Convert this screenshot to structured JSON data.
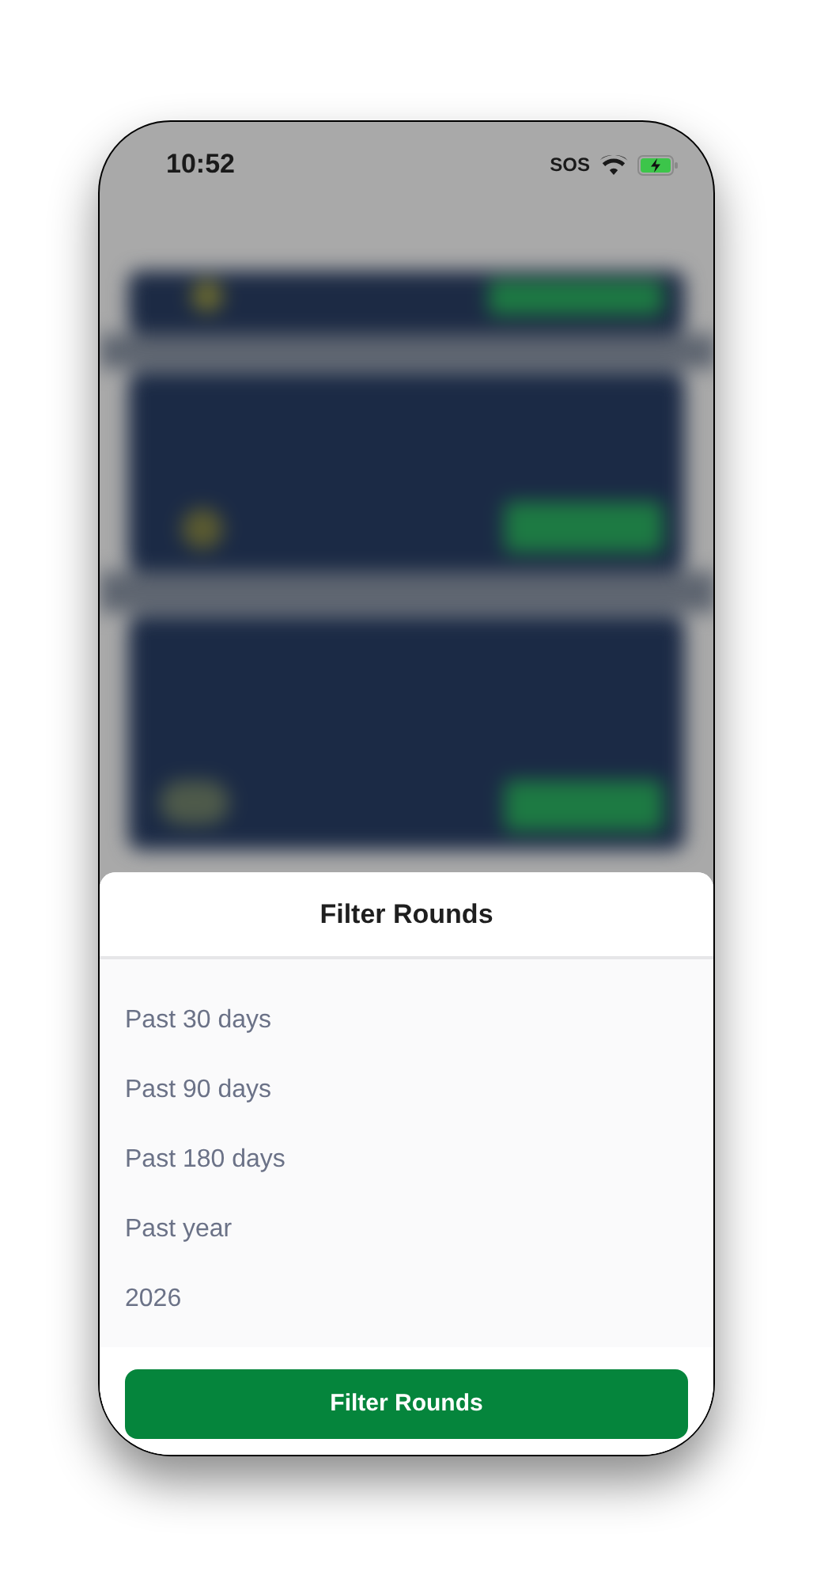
{
  "status_bar": {
    "time": "10:52",
    "carrier_text": "SOS"
  },
  "sheet": {
    "title": "Filter Rounds",
    "options": [
      {
        "label": "Past 30 days"
      },
      {
        "label": "Past 90 days"
      },
      {
        "label": "Past 180 days"
      },
      {
        "label": "Past year"
      },
      {
        "label": "2026"
      }
    ],
    "button": "Filter Rounds"
  }
}
